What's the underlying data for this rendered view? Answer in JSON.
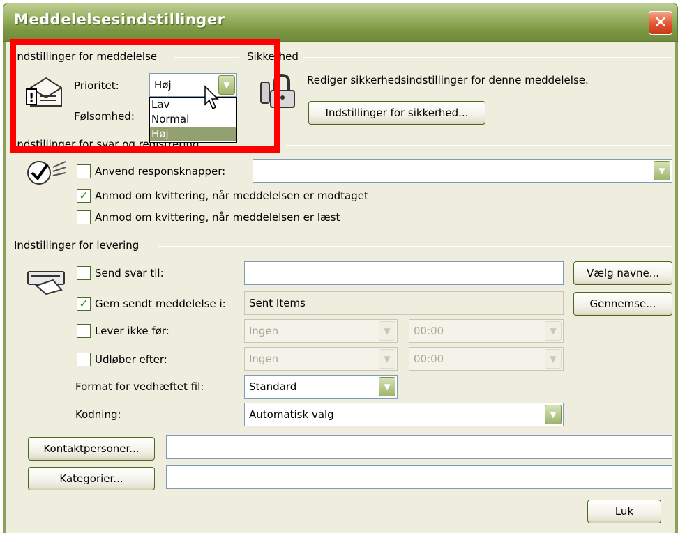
{
  "window": {
    "title": "Meddelelsesindstillinger",
    "close_glyph": "✕"
  },
  "message_settings": {
    "heading": "Indstillinger for meddelelse",
    "priority_label": "Prioritet:",
    "priority_value": "Høj",
    "priority_options": [
      "Lav",
      "Normal",
      "Høj"
    ],
    "sensitivity_label": "Følsomhed:"
  },
  "security": {
    "heading": "Sikkerhed",
    "description": "Rediger sikkerhedsindstillinger for denne meddelelse.",
    "button": "Indstillinger for sikkerhed..."
  },
  "reply_tracking": {
    "heading": "Indstillinger for svar og registrering",
    "use_voting_buttons": {
      "label": "Anvend responsknapper:",
      "checked": false,
      "value": ""
    },
    "request_delivery_receipt": {
      "label": "Anmod om kvittering, når meddelelsen er modtaget",
      "checked": true
    },
    "request_read_receipt": {
      "label": "Anmod om kvittering, når meddelelsen er læst",
      "checked": false
    }
  },
  "delivery": {
    "heading": "Indstillinger for levering",
    "send_replies_to": {
      "label": "Send svar til:",
      "checked": false,
      "value": "",
      "button": "Vælg navne..."
    },
    "save_sent": {
      "label": "Gem sendt meddelelse i:",
      "checked": true,
      "value": "Sent Items",
      "button": "Gennemse..."
    },
    "do_not_deliver_before": {
      "label": "Lever ikke før:",
      "checked": false,
      "date": "Ingen",
      "time": "00:00"
    },
    "expires_after": {
      "label": "Udløber efter:",
      "checked": false,
      "date": "Ingen",
      "time": "00:00"
    },
    "attachment_format": {
      "label": "Format for vedhæftet fil:",
      "value": "Standard"
    },
    "encoding": {
      "label": "Kodning:",
      "value": "Automatisk valg"
    }
  },
  "footer": {
    "contacts_button": "Kontaktpersoner...",
    "contacts_value": "",
    "categories_button": "Kategorier...",
    "categories_value": "",
    "close_button": "Luk"
  },
  "icons": {
    "message": "envelope-priority-icon",
    "security": "padlock-icon",
    "tracking": "checkmark-tracking-icon",
    "delivery": "delivery-hand-icon",
    "combo_arrow": "▼"
  },
  "colors": {
    "title_green": "#7d9844",
    "dialog_bg": "#eeedde",
    "highlight_red": "#ff0000",
    "selection": "#93a070"
  }
}
